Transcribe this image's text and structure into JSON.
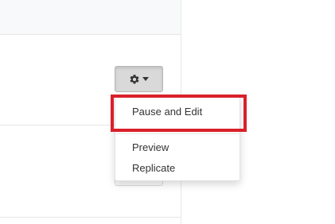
{
  "toolbar": {
    "settings_button": {
      "icon": "gear-icon",
      "caret_icon": "caret-down-icon"
    }
  },
  "dropdown": {
    "items": [
      {
        "label": "Pause and Edit",
        "highlighted": true
      },
      {
        "label": "Preview"
      },
      {
        "label": "Replicate"
      }
    ]
  },
  "colors": {
    "highlight": "#d9202a",
    "button_bg": "#d9d9d9",
    "text": "#333333",
    "header_bg": "#f8f9fa"
  }
}
